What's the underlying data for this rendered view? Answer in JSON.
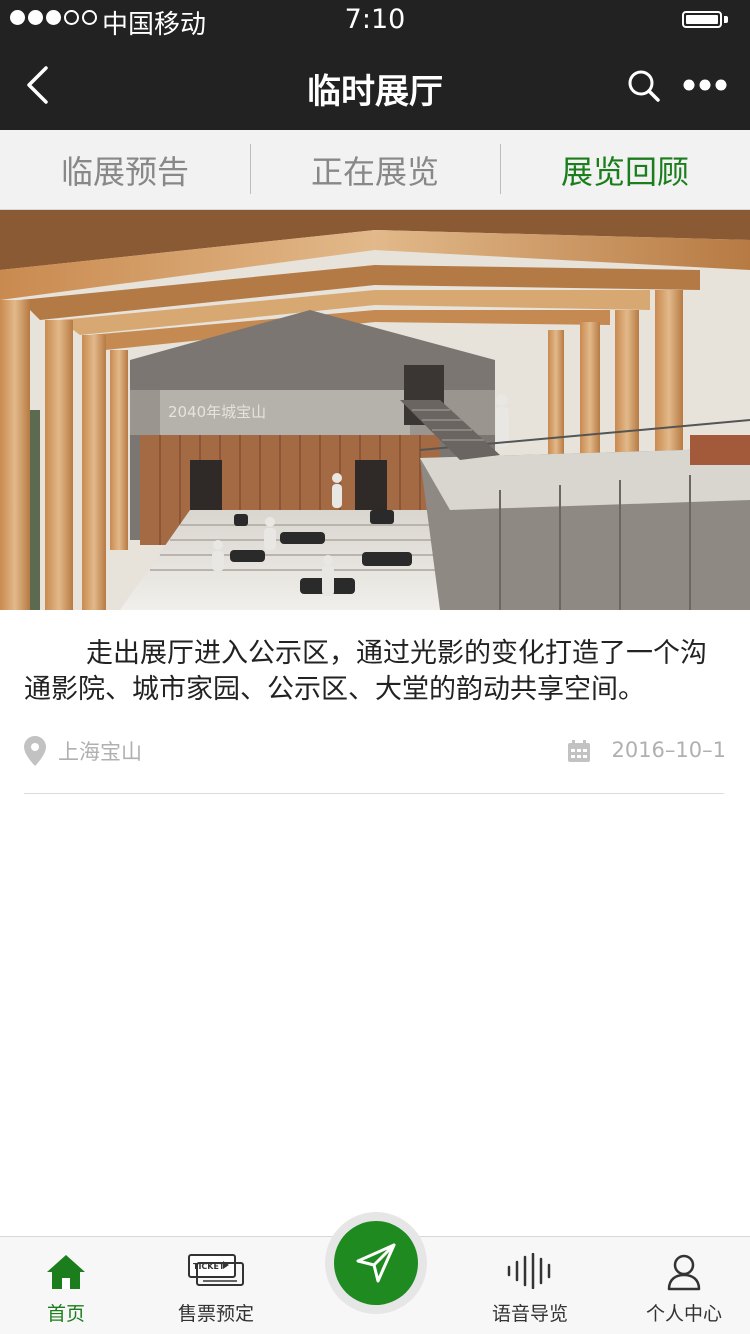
{
  "status_bar": {
    "carrier": "中国移动",
    "time": "7:10"
  },
  "nav": {
    "title": "临时展厅"
  },
  "tabs": [
    {
      "label": "临展预告",
      "active": false
    },
    {
      "label": "正在展览",
      "active": false
    },
    {
      "label": "展览回顾",
      "active": true
    }
  ],
  "hero": {
    "sign_text": "2040年城宝山"
  },
  "article": {
    "description": "走出展厅进入公示区，通过光影的变化打造了一个沟通影院、城市家园、公示区、大堂的韵动共享空间。",
    "location": "上海宝山",
    "date": "2016–10–1"
  },
  "tabbar": {
    "home_label": "首页",
    "tickets_label": "售票预定",
    "ticket_icon_text": "TICKET",
    "audio_label": "语音导览",
    "profile_label": "个人中心"
  },
  "colors": {
    "accent": "#1c7d1c",
    "bar": "#222222"
  }
}
